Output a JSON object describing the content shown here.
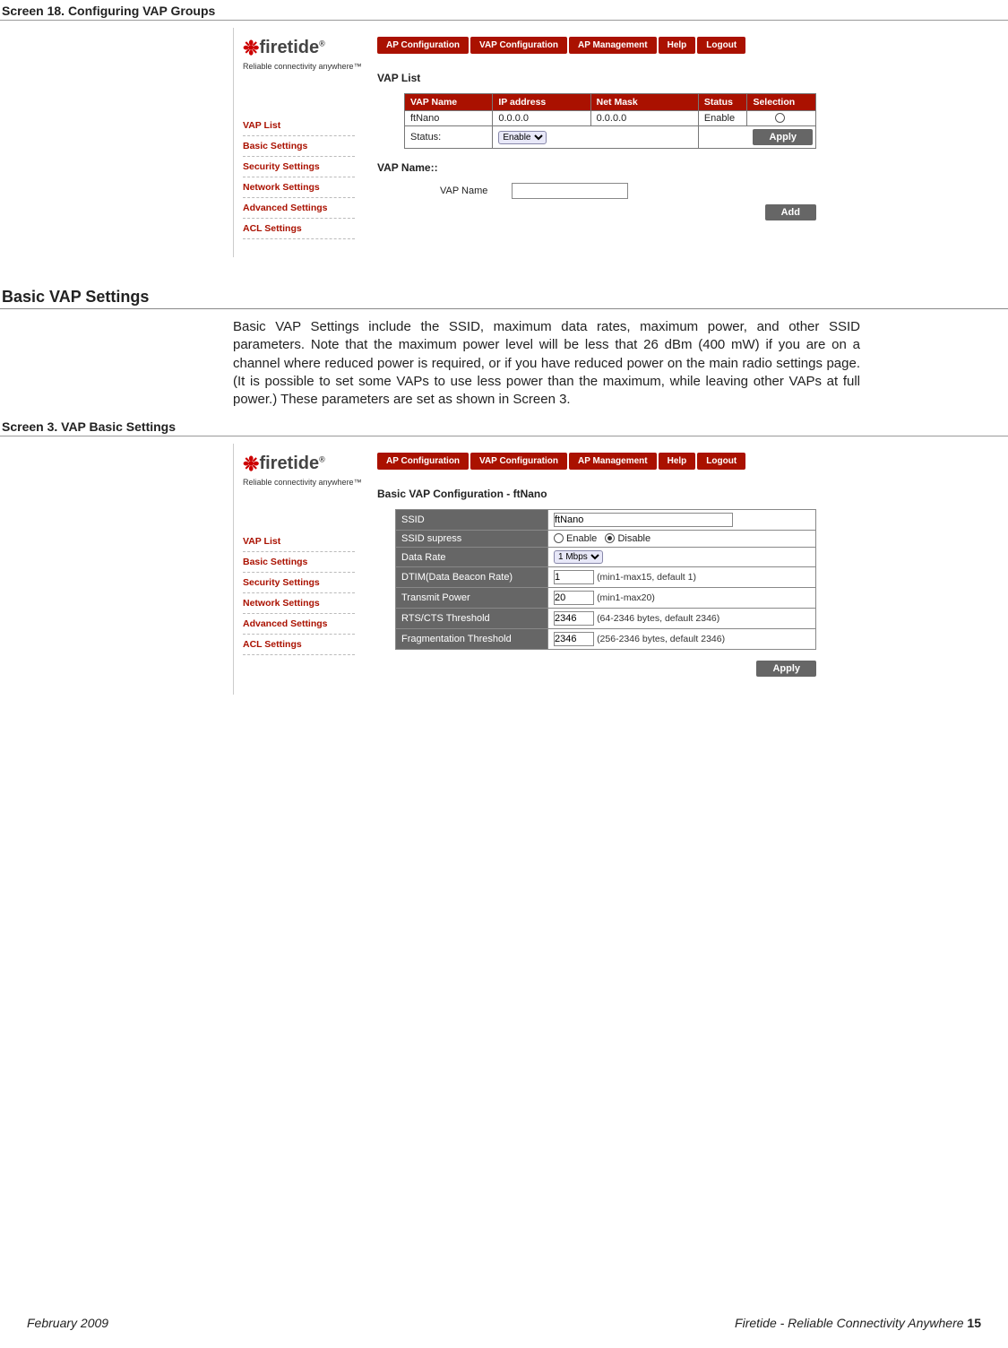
{
  "captions": {
    "s18": "Screen 18. Configuring VAP Groups",
    "s3": "Screen 3. VAP Basic Settings"
  },
  "section_heading": "Basic VAP Settings",
  "logo": {
    "name": "firetide",
    "tagline": "Reliable connectivity anywhere™"
  },
  "tabs": [
    "AP Configuration",
    "VAP Configuration",
    "AP Management",
    "Help",
    "Logout"
  ],
  "sidebar": [
    "VAP List",
    "Basic Settings",
    "Security Settings",
    "Network Settings",
    "Advanced Settings",
    "ACL Settings"
  ],
  "screen18": {
    "panel_title": "VAP List",
    "cols": [
      "VAP Name",
      "IP address",
      "Net Mask",
      "Status",
      "Selection"
    ],
    "row": {
      "name": "ftNano",
      "ip": "0.0.0.0",
      "mask": "0.0.0.0",
      "status": "Enable"
    },
    "status_label": "Status:",
    "status_select": "Enable",
    "apply": "Apply",
    "sub_title": "VAP Name::",
    "input_label": "VAP Name",
    "add": "Add"
  },
  "para": "Basic VAP Settings include the SSID, maximum data rates, maximum power, and other SSID parameters. Note that the maximum power level will be less that 26 dBm (400 mW) if you are on a channel where reduced power is required, or if you have reduced power on the main radio settings page. (It is possible to set some VAPs to use less power than the maximum, while leaving other VAPs at full power.) These parameters are set as shown in Screen 3.",
  "screen3": {
    "panel_title": "Basic VAP Configuration - ftNano",
    "fields": {
      "ssid": {
        "label": "SSID",
        "value": "ftNano"
      },
      "supress": {
        "label": "SSID supress",
        "enable": "Enable",
        "disable": "Disable"
      },
      "rate": {
        "label": "Data Rate",
        "value": "1 Mbps"
      },
      "dtim": {
        "label": "DTIM(Data Beacon Rate)",
        "value": "1",
        "hint": "(min1-max15, default 1)"
      },
      "tx": {
        "label": "Transmit Power",
        "value": "20",
        "hint": "(min1-max20)"
      },
      "rts": {
        "label": "RTS/CTS Threshold",
        "value": "2346",
        "hint": "(64-2346 bytes, default 2346)"
      },
      "frag": {
        "label": "Fragmentation Threshold",
        "value": "2346",
        "hint": "(256-2346 bytes, default 2346)"
      }
    },
    "apply": "Apply"
  },
  "footer": {
    "left": "February 2009",
    "right_text": "Firetide - Reliable Connectivity Anywhere ",
    "page": "15"
  }
}
